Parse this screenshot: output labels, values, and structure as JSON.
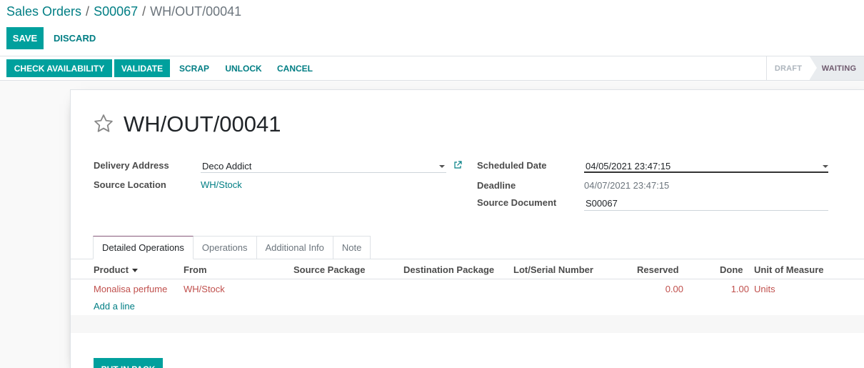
{
  "breadcrumb": {
    "items": [
      "Sales Orders",
      "S00067"
    ],
    "separator": "/",
    "current": "WH/OUT/00041"
  },
  "form_buttons": {
    "save": "SAVE",
    "discard": "DISCARD"
  },
  "header_buttons": {
    "check_availability": "CHECK AVAILABILITY",
    "validate": "VALIDATE",
    "scrap": "SCRAP",
    "unlock": "UNLOCK",
    "cancel": "CANCEL"
  },
  "stages": {
    "draft": "DRAFT",
    "waiting": "WAITING",
    "active": "WAITING"
  },
  "record": {
    "title": "WH/OUT/00041",
    "favorite_icon": "star-outline-icon"
  },
  "fields": {
    "delivery_address": {
      "label": "Delivery Address",
      "value": "Deco Addict"
    },
    "source_location": {
      "label": "Source Location",
      "value": "WH/Stock"
    },
    "scheduled_date": {
      "label": "Scheduled Date",
      "value": "04/05/2021 23:47:15"
    },
    "deadline": {
      "label": "Deadline",
      "value": "04/07/2021 23:47:15"
    },
    "source_document": {
      "label": "Source Document",
      "value": "S00067"
    }
  },
  "tabs": [
    {
      "label": "Detailed Operations",
      "active": true
    },
    {
      "label": "Operations",
      "active": false
    },
    {
      "label": "Additional Info",
      "active": false
    },
    {
      "label": "Note",
      "active": false
    }
  ],
  "table": {
    "columns": [
      "Product",
      "From",
      "Source Package",
      "Destination Package",
      "Lot/Serial Number",
      "Reserved",
      "Done",
      "Unit of Measure"
    ],
    "rows": [
      {
        "product": "Monalisa perfume",
        "from": "WH/Stock",
        "source_package": "",
        "destination_package": "",
        "lot": "",
        "reserved": "0.00",
        "done": "1.00",
        "uom": "Units"
      }
    ],
    "add_line": "Add a line"
  },
  "footer_buttons": {
    "put_in_pack": "PUT IN PACK"
  },
  "colors": {
    "primary": "#00a09d",
    "link": "#017e84",
    "row_text": "#c0504d",
    "tab_accent": "#875a7b"
  }
}
